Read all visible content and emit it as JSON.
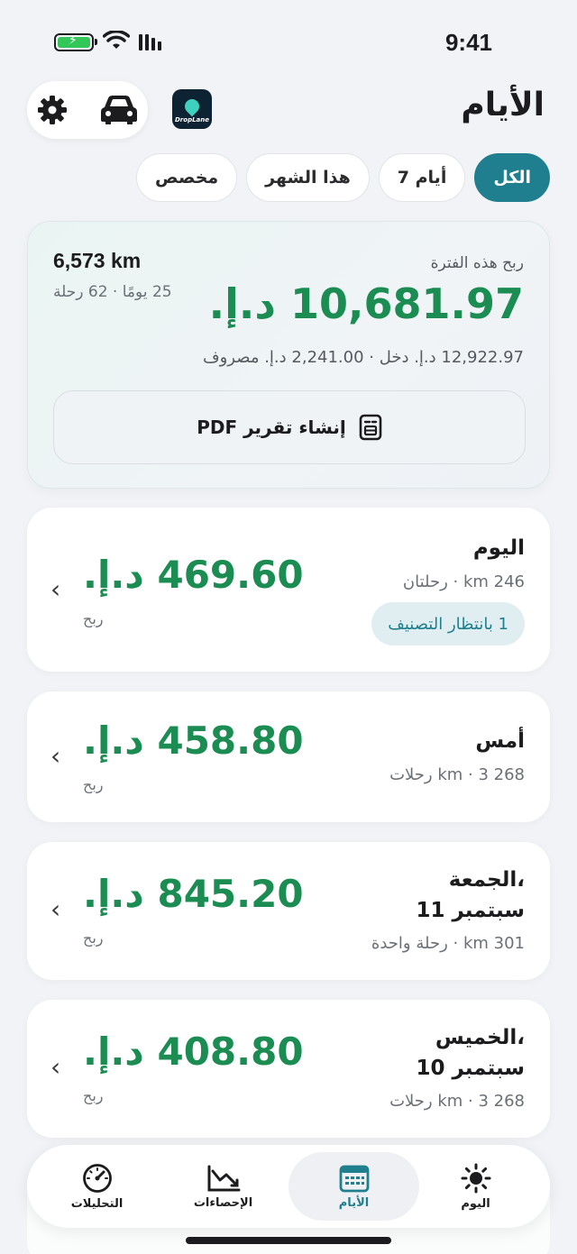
{
  "status_bar": {
    "time": "9:41"
  },
  "header": {
    "title": "الأيام",
    "logo_text": "DropLane"
  },
  "filters": {
    "chips": [
      {
        "label": "الكل",
        "active": true
      },
      {
        "label": "7 أيام",
        "active": false
      },
      {
        "label": "هذا الشهر",
        "active": false
      },
      {
        "label": "مخصص",
        "active": false
      }
    ]
  },
  "summary": {
    "label": "ربح هذه الفترة",
    "amount": "10,681.97 د.إ.",
    "distance": "6,573 km",
    "days_trips": "25 يومًا · 62 رحلة",
    "breakdown": "12,922.97 د.إ. دخل · 2,241.00 د.إ. مصروف",
    "pdf_button": "إنشاء تقرير PDF"
  },
  "days": [
    {
      "title": "اليوم",
      "meta": "246 km · رحلتان",
      "amount": "469.60 د.إ.",
      "amount_label": "ربح",
      "badge": "1 بانتظار التصنيف"
    },
    {
      "title": "أمس",
      "meta": "268 km · 3 رحلات",
      "amount": "458.80 د.إ.",
      "amount_label": "ربح"
    },
    {
      "title_line1": "الجمعة،",
      "title_line2": "11 سبتمبر",
      "meta": "301 km · رحلة واحدة",
      "amount": "845.20 د.إ.",
      "amount_label": "ربح"
    },
    {
      "title_line1": "الخميس،",
      "title_line2": "10 سبتمبر",
      "meta": "268 km · 3 رحلات",
      "amount": "408.80 د.إ.",
      "amount_label": "ربح"
    }
  ],
  "tabs": [
    {
      "label": "اليوم",
      "icon": "sun-icon",
      "active": false
    },
    {
      "label": "الأيام",
      "icon": "calendar-icon",
      "active": true
    },
    {
      "label": "الإحصاءات",
      "icon": "chart-icon",
      "active": false
    },
    {
      "label": "التحليلات",
      "icon": "gauge-icon",
      "active": false
    }
  ],
  "colors": {
    "accent": "#1f7f8e",
    "profit": "#1b8c52",
    "background": "#f1f3f6"
  }
}
